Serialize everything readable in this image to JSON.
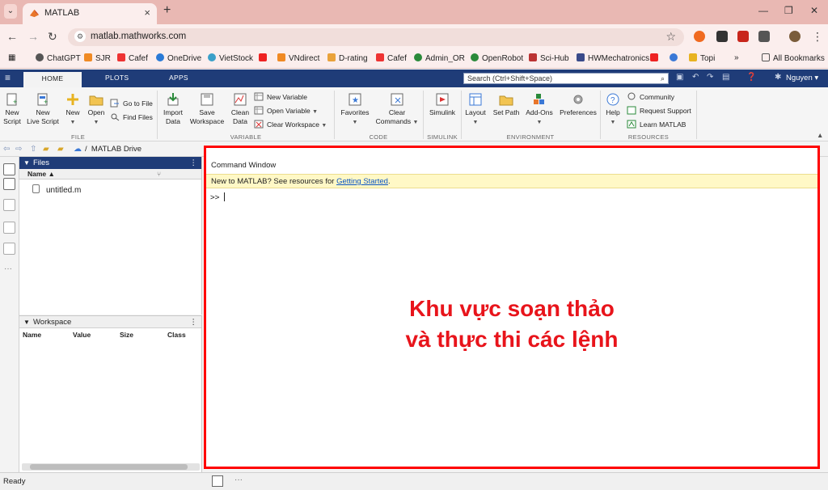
{
  "browser": {
    "tab_title": "MATLAB",
    "new_tab_symbol": "+",
    "url": "matlab.mathworks.com",
    "bookmarks": [
      "ChatGPT",
      "SJR",
      "Cafef",
      "OneDrive",
      "VietStock",
      "VNdirect",
      "D-rating",
      "Cafef",
      "Admin_OR",
      "OpenRobot",
      "Sci-Hub",
      "HWMechatronics",
      "Topi"
    ],
    "all_bookmarks": "All Bookmarks"
  },
  "matlab": {
    "tabs": [
      "HOME",
      "PLOTS",
      "APPS"
    ],
    "search_placeholder": "Search (Ctrl+Shift+Space)",
    "user": "Nguyen",
    "ribbon": {
      "new_script": "New\nScript",
      "new_live_script": "New\nLive Script",
      "new": "New",
      "open": "Open",
      "go_to_file": "Go to File",
      "find_files": "Find Files",
      "import_data": "Import\nData",
      "save_workspace": "Save\nWorkspace",
      "clean_data": "Clean\nData",
      "new_variable": "New Variable",
      "open_variable": "Open Variable",
      "clear_workspace": "Clear Workspace",
      "favorites": "Favorites",
      "clear_commands": "Clear\nCommands",
      "simulink": "Simulink",
      "layout": "Layout",
      "set_path": "Set Path",
      "add_ons": "Add-Ons",
      "preferences": "Preferences",
      "help": "Help",
      "community": "Community",
      "request_support": "Request Support",
      "learn_matlab": "Learn MATLAB",
      "sections": {
        "file": "FILE",
        "variable": "VARIABLE",
        "code": "CODE",
        "simulink": "SIMULINK",
        "environment": "ENVIRONMENT",
        "resources": "RESOURCES"
      }
    },
    "path": "MATLAB Drive",
    "files_panel": {
      "title": "Files",
      "col_name": "Name ▲",
      "items": [
        "untitled.m"
      ]
    },
    "workspace_panel": {
      "title": "Workspace",
      "columns": [
        "Name",
        "Value",
        "Size",
        "Class"
      ]
    },
    "command_window": {
      "title": "Command Window",
      "banner_text": "New to MATLAB? See resources for ",
      "banner_link": "Getting Started",
      "banner_end": ".",
      "prompt": ">>"
    },
    "annotation": {
      "line1": "Khu vực soạn thảo",
      "line2": "và thực thi các lệnh"
    },
    "status": "Ready"
  }
}
